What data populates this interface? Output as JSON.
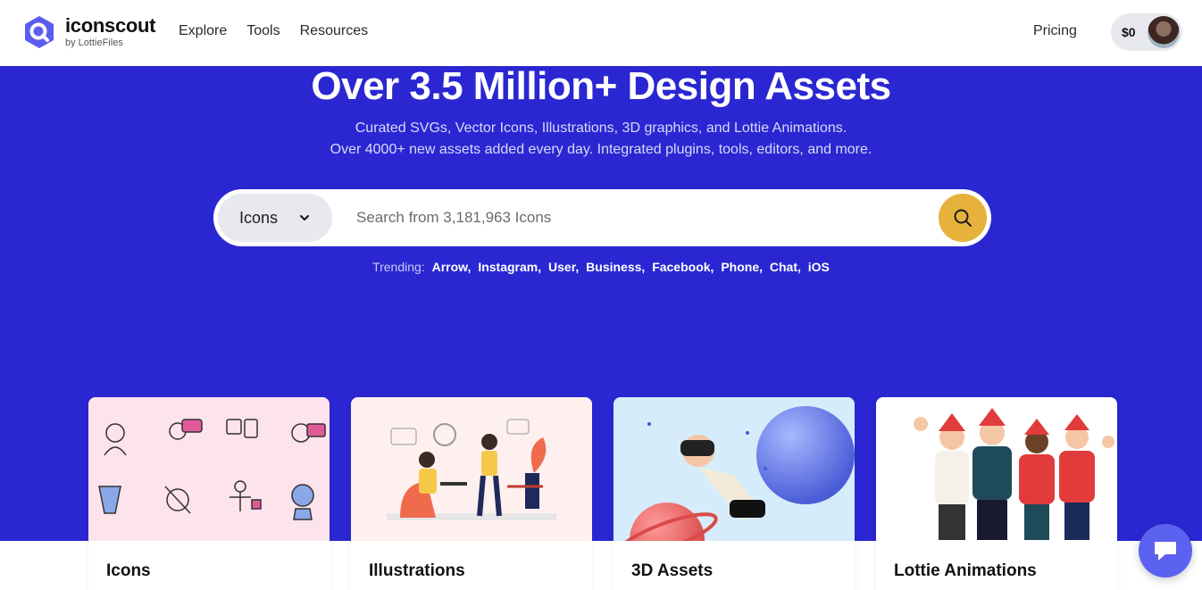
{
  "header": {
    "logo_name": "iconscout",
    "logo_sub": "by LottieFiles",
    "nav": [
      "Explore",
      "Tools",
      "Resources"
    ],
    "pricing": "Pricing",
    "wallet_amount": "$0"
  },
  "hero": {
    "title": "Over 3.5 Million+ Design Assets",
    "subtitle_line1": "Curated SVGs, Vector Icons, Illustrations, 3D graphics, and Lottie Animations.",
    "subtitle_line2": "Over 4000+ new assets added every day. Integrated plugins, tools, editors, and more.",
    "bg_color": "#2a27d2"
  },
  "search": {
    "type_label": "Icons",
    "placeholder": "Search from 3,181,963 Icons",
    "button_color": "#e6b23c"
  },
  "trending": {
    "label": "Trending:",
    "items": [
      "Arrow,",
      "Instagram,",
      "User,",
      "Business,",
      "Facebook,",
      "Phone,",
      "Chat,",
      "iOS"
    ]
  },
  "cards": [
    {
      "label": "Icons",
      "bg": "#fde3ec"
    },
    {
      "label": "Illustrations",
      "bg": "#fdf0ee"
    },
    {
      "label": "3D Assets",
      "bg": "#d6ecfa"
    },
    {
      "label": "Lottie Animations",
      "bg": "#ffffff"
    }
  ]
}
